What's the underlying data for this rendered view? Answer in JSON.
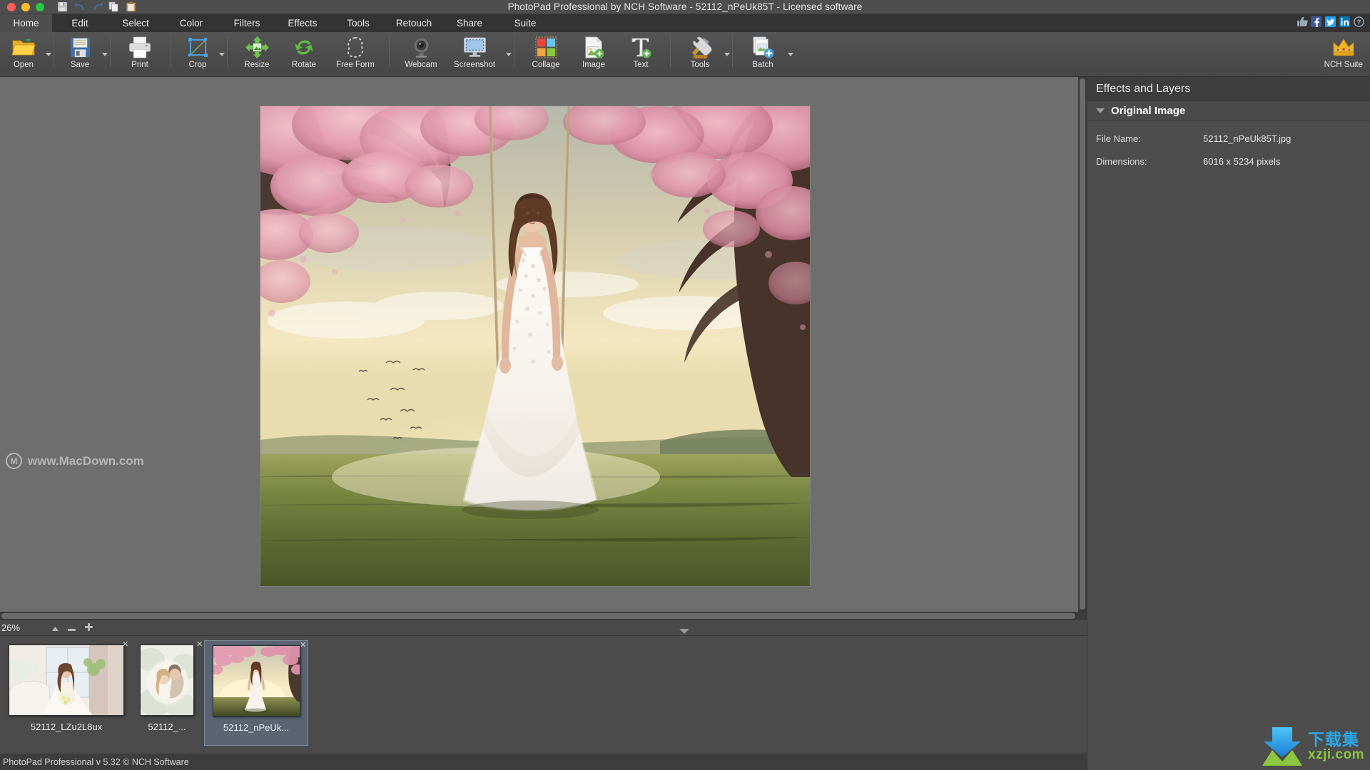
{
  "window": {
    "title": "PhotoPad Professional by NCH Software - 52112_nPeUk85T - Licensed software",
    "traffic_lights": [
      "close",
      "minimize",
      "maximize"
    ],
    "quick_access": [
      "save-icon",
      "undo-icon",
      "redo-icon",
      "copy-icon",
      "paste-icon"
    ]
  },
  "tabs": [
    {
      "label": "Home",
      "active": true
    },
    {
      "label": "Edit",
      "active": false
    },
    {
      "label": "Select",
      "active": false
    },
    {
      "label": "Color",
      "active": false
    },
    {
      "label": "Filters",
      "active": false
    },
    {
      "label": "Effects",
      "active": false
    },
    {
      "label": "Tools",
      "active": false
    },
    {
      "label": "Retouch",
      "active": false
    },
    {
      "label": "Share",
      "active": false
    },
    {
      "label": "Suite",
      "active": false
    }
  ],
  "social": [
    {
      "name": "thumbs-up-icon",
      "color": "#8a9aac"
    },
    {
      "name": "facebook-icon",
      "color": "#3b5998"
    },
    {
      "name": "twitter-icon",
      "color": "#1da1f2"
    },
    {
      "name": "linkedin-icon",
      "color": "#0077b5"
    },
    {
      "name": "help-icon",
      "color": "#5b7fa6"
    }
  ],
  "ribbon": {
    "items": [
      {
        "label": "Open",
        "icon": "open-folder-icon",
        "dropdown": true
      },
      {
        "label": "Save",
        "icon": "floppy-disk-icon",
        "dropdown": true
      },
      {
        "label": "Print",
        "icon": "printer-icon",
        "dropdown": false
      },
      {
        "label": "Crop",
        "icon": "crop-icon",
        "dropdown": true
      },
      {
        "label": "Resize",
        "icon": "resize-arrows-icon",
        "dropdown": false
      },
      {
        "label": "Rotate",
        "icon": "rotate-icon",
        "dropdown": false
      },
      {
        "label": "Free Form",
        "icon": "free-form-icon",
        "dropdown": false
      },
      {
        "label": "Webcam",
        "icon": "webcam-icon",
        "dropdown": false
      },
      {
        "label": "Screenshot",
        "icon": "screenshot-icon",
        "dropdown": true
      },
      {
        "label": "Collage",
        "icon": "collage-icon",
        "dropdown": false
      },
      {
        "label": "Image",
        "icon": "add-image-icon",
        "dropdown": false
      },
      {
        "label": "Text",
        "icon": "add-text-icon",
        "dropdown": false
      },
      {
        "label": "Tools",
        "icon": "hammer-wrench-icon",
        "dropdown": true
      },
      {
        "label": "Batch",
        "icon": "batch-icon",
        "dropdown": true
      }
    ],
    "nch_suite": {
      "label": "NCH Suite",
      "icon": "nch-crown-icon"
    }
  },
  "canvas": {
    "watermark": {
      "text": "www.MacDown.com",
      "monogram": "M"
    },
    "zoom_level": "26%",
    "zoom_buttons": [
      "fit-zoom",
      "zoom-out",
      "zoom-in"
    ]
  },
  "right_panel": {
    "title": "Effects and Layers",
    "section": {
      "label": "Original Image",
      "expanded": true
    },
    "properties": [
      {
        "key": "File Name:",
        "value": "52112_nPeUk85T.jpg"
      },
      {
        "key": "Dimensions:",
        "value": "6016 x 5234 pixels"
      }
    ]
  },
  "thumbnails": [
    {
      "label": "52112_LZu2L8ux",
      "selected": false,
      "close": "×"
    },
    {
      "label": "52112_...",
      "selected": false,
      "close": "×"
    },
    {
      "label": "52112_nPeUk...",
      "selected": true,
      "close": "×"
    }
  ],
  "statusbar": {
    "text": "PhotoPad Professional v 5.32 © NCH Software"
  },
  "branding": {
    "cn": "下载集",
    "en": "xzji.com"
  }
}
